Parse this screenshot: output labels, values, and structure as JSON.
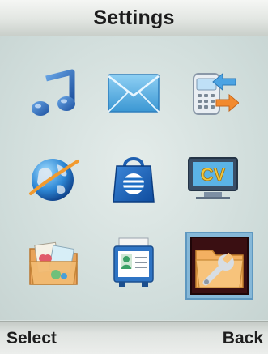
{
  "header": {
    "title": "Settings"
  },
  "menu": {
    "selected_index": 8,
    "items": [
      {
        "icon": "music-note-icon"
      },
      {
        "icon": "envelope-icon"
      },
      {
        "icon": "phone-transfer-icon"
      },
      {
        "icon": "globe-icon"
      },
      {
        "icon": "att-shopping-bag-icon"
      },
      {
        "icon": "cv-tv-icon"
      },
      {
        "icon": "media-folder-icon"
      },
      {
        "icon": "contact-card-icon"
      },
      {
        "icon": "settings-folder-wrench-icon"
      }
    ]
  },
  "softkeys": {
    "left": "Select",
    "right": "Back"
  },
  "colors": {
    "selection": "#86b8d8",
    "title_text": "#1c1c1c"
  }
}
